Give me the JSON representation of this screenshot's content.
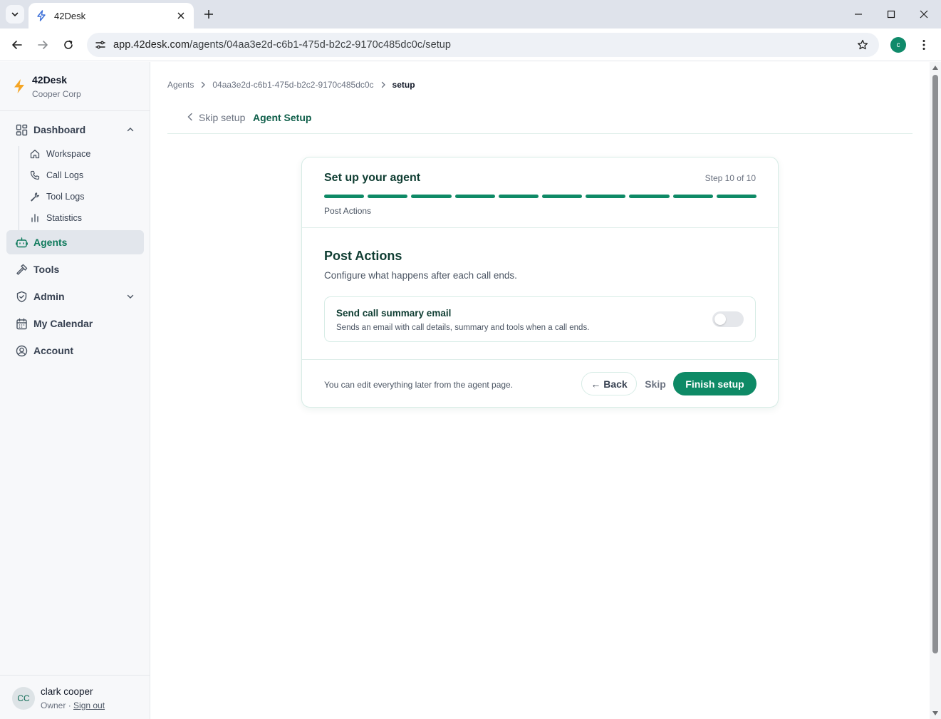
{
  "browser": {
    "tab_title": "42Desk",
    "url_host": "app.42desk.com",
    "url_path": "/agents/04aa3e2d-c6b1-475d-b2c2-9170c485dc0c/setup",
    "profile_initial": "c"
  },
  "sidebar": {
    "brand_name": "42Desk",
    "brand_org": "Cooper Corp",
    "dashboard_label": "Dashboard",
    "sub_items": [
      {
        "label": "Workspace",
        "icon": "home-icon"
      },
      {
        "label": "Call Logs",
        "icon": "phone-icon"
      },
      {
        "label": "Tool Logs",
        "icon": "wrench-icon"
      },
      {
        "label": "Statistics",
        "icon": "bar-chart-icon"
      }
    ],
    "items": [
      {
        "label": "Agents",
        "icon": "bot-icon",
        "active": true
      },
      {
        "label": "Tools",
        "icon": "hammer-icon"
      },
      {
        "label": "Admin",
        "icon": "shield-icon"
      },
      {
        "label": "My Calendar",
        "icon": "calendar-icon"
      },
      {
        "label": "Account",
        "icon": "user-circle-icon"
      }
    ],
    "user": {
      "initials": "CC",
      "name": "clark cooper",
      "role": "Owner",
      "separator": "·",
      "sign_out": "Sign out"
    }
  },
  "breadcrumb": {
    "root": "Agents",
    "id": "04aa3e2d-c6b1-475d-b2c2-9170c485dc0c",
    "current": "setup"
  },
  "page": {
    "skip_setup": "Skip setup",
    "title": "Agent Setup"
  },
  "wizard": {
    "title": "Set up your agent",
    "step_label": "Step 10 of 10",
    "current_step": 10,
    "total_steps": 10,
    "step_name": "Post Actions",
    "section_title": "Post Actions",
    "section_desc": "Configure what happens after each call ends.",
    "option": {
      "title": "Send call summary email",
      "desc": "Sends an email with call details, summary and tools when a call ends.",
      "enabled": false
    },
    "footer_note": "You can edit everything later from the agent page.",
    "back_label": "← Back",
    "skip_label": "Skip",
    "finish_label": "Finish setup"
  },
  "colors": {
    "accent": "#0e8a66",
    "accent_dark": "#0f3d32",
    "sidebar_active_bg": "#e2e6ec"
  }
}
